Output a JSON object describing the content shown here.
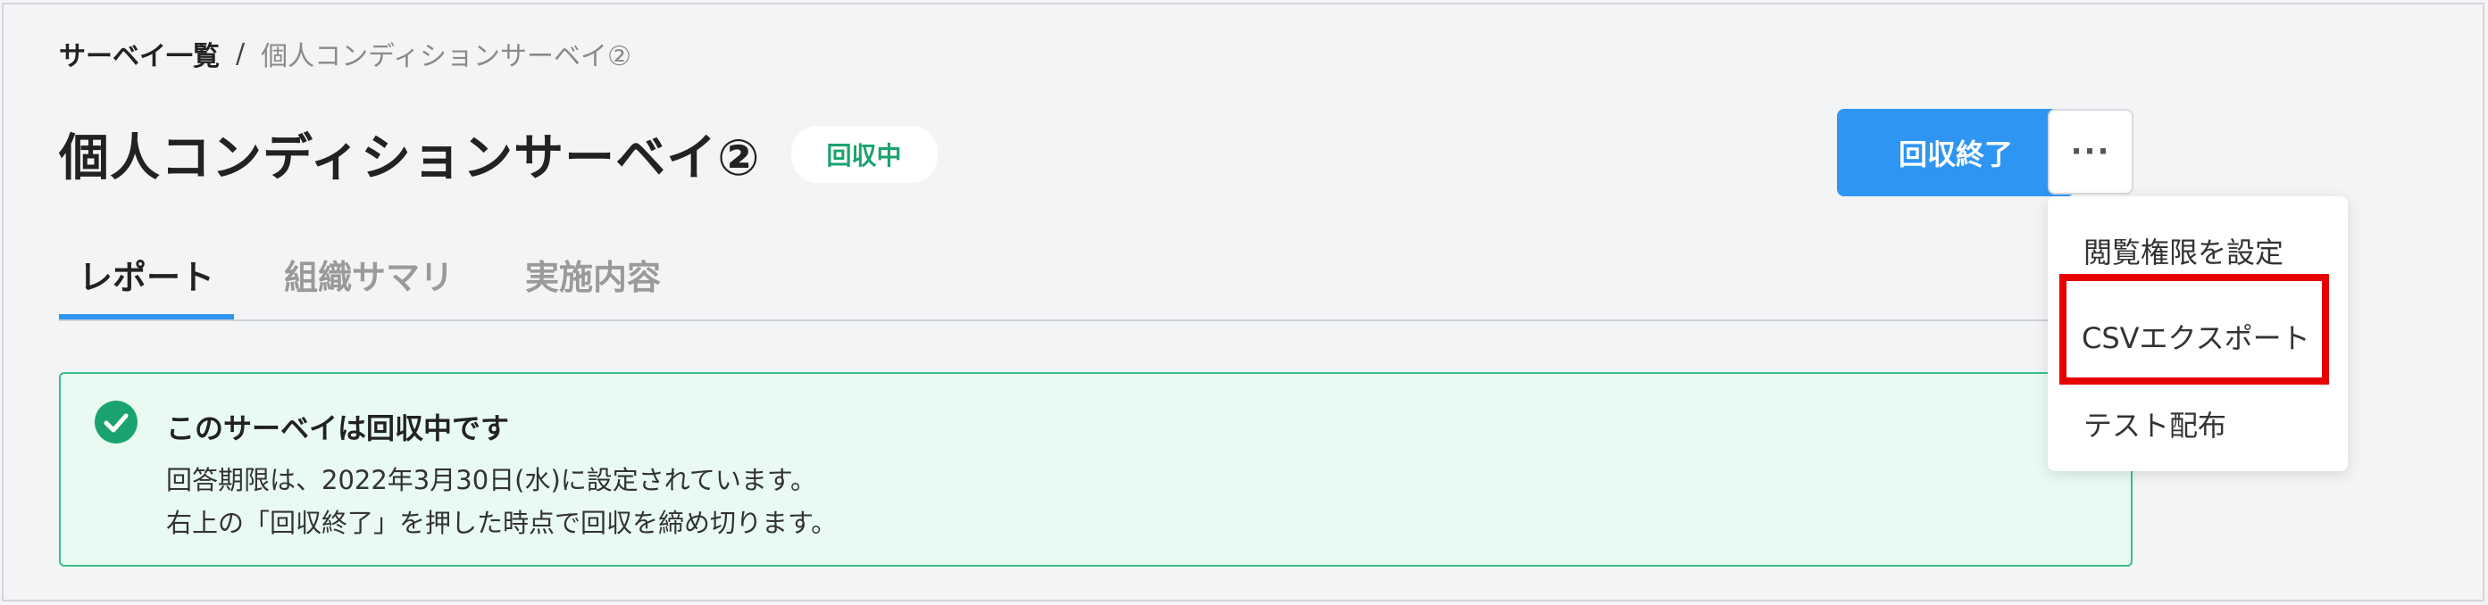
{
  "breadcrumb": {
    "parent": "サーベイ一覧",
    "separator": "/",
    "current": "個人コンディションサーベイ②"
  },
  "header": {
    "title": "個人コンディションサーベイ②",
    "status": "回収中",
    "close_button": "回収終了",
    "more_button": "···"
  },
  "tabs": [
    {
      "label": "レポート",
      "active": true
    },
    {
      "label": "組織サマリ",
      "active": false
    },
    {
      "label": "実施内容",
      "active": false
    }
  ],
  "notice": {
    "icon": "check-circle-icon",
    "title": "このサーベイは回収中です",
    "line1": "回答期限は、2022年3月30日(水)に設定されています。",
    "line2": "右上の「回収終了」を押した時点で回収を締め切ります。"
  },
  "menu": {
    "items": [
      {
        "label": "閲覧権限を設定"
      },
      {
        "label": "CSVエクスポート",
        "highlighted": true
      },
      {
        "label": "テスト配布"
      }
    ]
  },
  "colors": {
    "accent": "#2f95f3",
    "success": "#1aa36f",
    "notice_bg": "#e8faf2",
    "highlight": "#e60000"
  }
}
